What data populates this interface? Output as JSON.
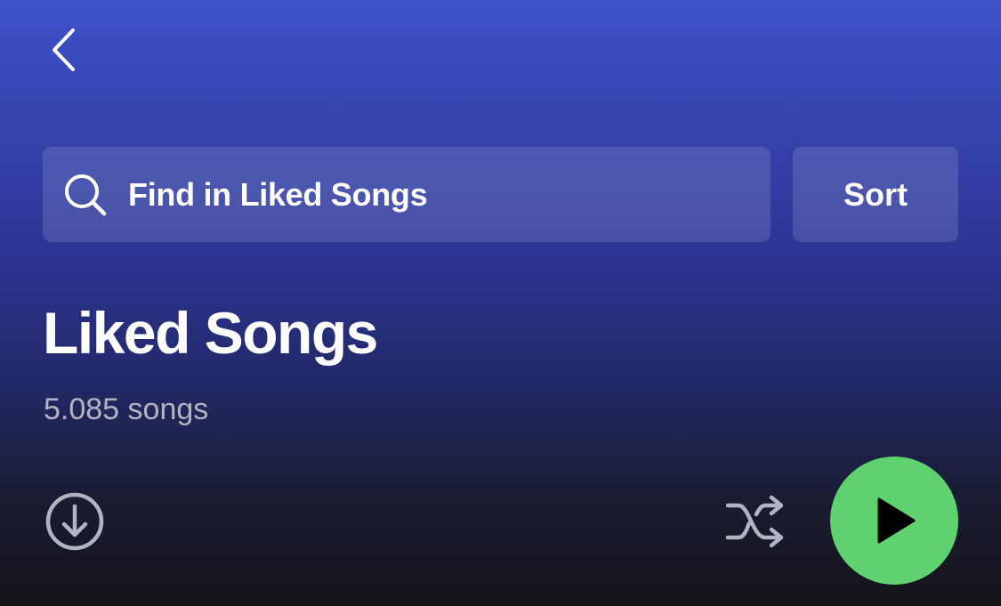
{
  "header": {
    "back_icon": "chevron-left-icon"
  },
  "search": {
    "icon": "search-icon",
    "placeholder": "Find in Liked Songs"
  },
  "sort": {
    "label": "Sort"
  },
  "playlist": {
    "title": "Liked Songs",
    "song_count": "5.085 songs"
  },
  "actions": {
    "download_icon": "download-circle-icon",
    "shuffle_icon": "shuffle-icon",
    "play_icon": "play-icon"
  },
  "colors": {
    "background_top": "#3d52c9",
    "background_bottom": "#141418",
    "play_button": "#5fd26f",
    "secondary_text": "#b3b4c2"
  }
}
